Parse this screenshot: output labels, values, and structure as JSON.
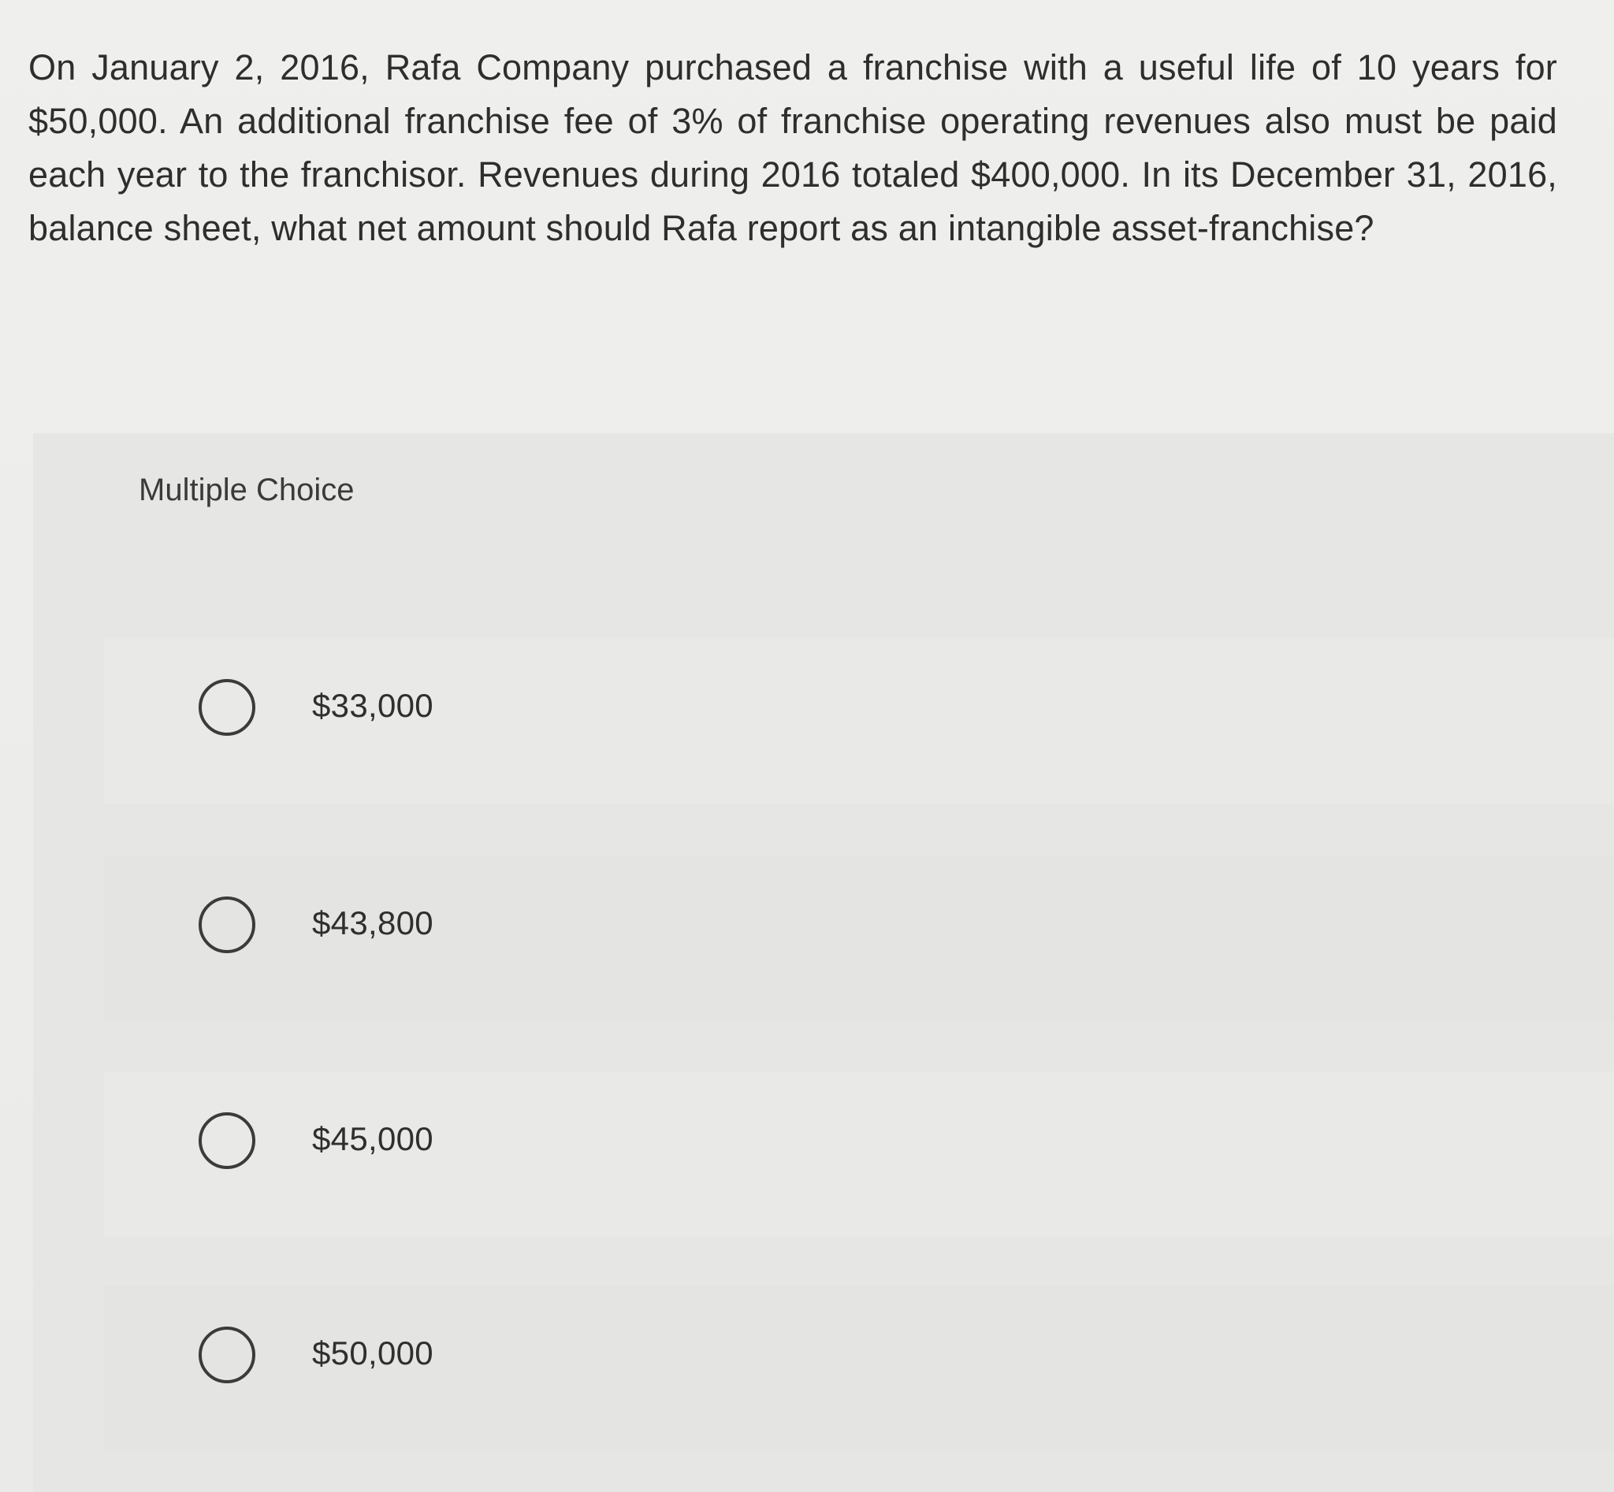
{
  "question": {
    "text": "On January 2, 2016, Rafa Company purchased a franchise with a useful life of 10 years for $50,000. An additional franchise fee of 3% of franchise operating revenues also must be paid each year to the franchisor. Revenues during 2016 totaled $400,000. In its December 31, 2016, balance sheet, what net amount should Rafa report as an intangible asset-franchise?"
  },
  "multiple_choice": {
    "title": "Multiple Choice",
    "options": [
      {
        "label": "$33,000"
      },
      {
        "label": "$43,800"
      },
      {
        "label": "$45,000"
      },
      {
        "label": "$50,000"
      }
    ]
  }
}
